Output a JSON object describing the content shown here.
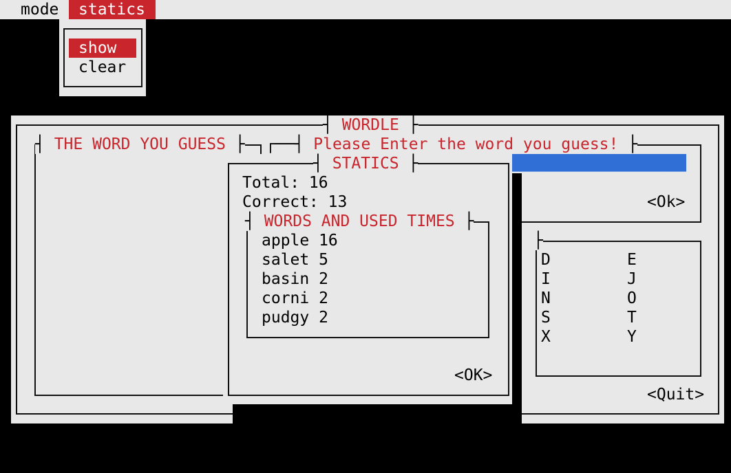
{
  "menubar": {
    "mode_label": "mode",
    "statics_label": "statics"
  },
  "statics_menu": {
    "items": [
      "show",
      "clear"
    ],
    "selected": "show"
  },
  "wordle": {
    "title": "WORDLE",
    "guess_panel_title": "THE WORD YOU GUESS",
    "prompt_title": "Please Enter the word you guess!",
    "input_value": "___________________",
    "ok_button": "<Ok>",
    "quit_button": "<Quit>",
    "letters": {
      "col1": [
        "D",
        "I",
        "N",
        "S",
        "X"
      ],
      "col2": [
        "E",
        "J",
        "O",
        "T",
        "Y"
      ]
    }
  },
  "statics_dialog": {
    "title": "STATICS",
    "total": "Total: 16",
    "correct": "Correct: 13",
    "words_title": "WORDS AND USED TIMES",
    "words": [
      "apple 16",
      "salet 5",
      "basin 2",
      "corni 2",
      "pudgy 2"
    ],
    "ok_button": "<OK>"
  },
  "colors": {
    "accent": "#c8252c",
    "panel": "#e8e8e8",
    "input_bg": "#2f6fd6",
    "background": "#000000"
  }
}
